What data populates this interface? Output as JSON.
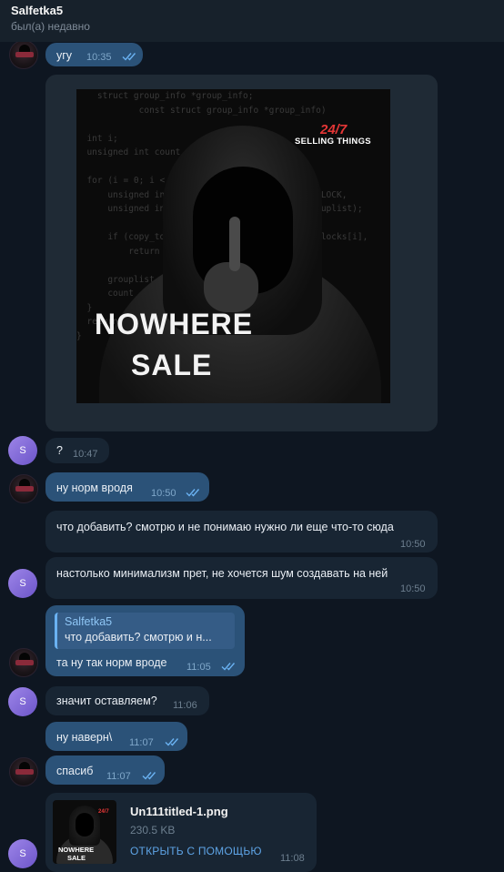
{
  "header": {
    "name": "Salfetka5",
    "status": "был(а) недавно"
  },
  "avatar_letter": "S",
  "poster": {
    "tag_top": "24/7",
    "tag_sub": "SELLING THINGS",
    "title_line1": "NOWHERE",
    "title_line2": "SALE",
    "code": "    struct group_info *group_info;\n            const struct group_info *group_info)\n\n  int i;\n  unsigned int count = group_info->ngroups;\n\n  for (i = 0; i < group_info->nblocks; i++) {\n      unsigned int cp_count = min(NGROUPS_PER_BLOCK,\n      unsigned int len = cp_count * sizeof(*grouplist);\n\n      if (copy_to_user(grouplist, group_info->blocks[i],\n          return -EFAULT;\n\n      grouplist += NGROUPS_PER_BLOCK;\n      count -= cp_count;\n  }\n  return 0;\n}"
  },
  "messages": {
    "m1": {
      "text": "угу",
      "time": "10:35"
    },
    "m2": {
      "text": "?",
      "time": "10:47"
    },
    "m3": {
      "text": "ну норм вродя",
      "time": "10:50"
    },
    "m4": {
      "text": "что добавить? смотрю и не понимаю нужно ли еще что-то сюда",
      "time": "10:50"
    },
    "m5": {
      "text": "настолько минимализм прет, не хочется шум создавать на ней",
      "time": "10:50"
    },
    "m6": {
      "reply_name": "Salfetka5",
      "reply_text": "что добавить? смотрю и н...",
      "text": "та ну так норм вроде",
      "time": "11:05"
    },
    "m7": {
      "text": "значит оставляем?",
      "time": "11:06"
    },
    "m8": {
      "text": "ну наверн\\",
      "time": "11:07"
    },
    "m9": {
      "text": "спасиб",
      "time": "11:07"
    }
  },
  "file": {
    "name": "Un111titled-1.png",
    "size": "230.5 KB",
    "open_label": "ОТКРЫТЬ С ПОМОЩЬЮ",
    "time": "11:08",
    "thumb_line1": "NOWHERE",
    "thumb_line2": "SALE",
    "thumb_tag": "24/7"
  },
  "colors": {
    "background": "#0e1621",
    "outgoing_bubble": "#2b5278",
    "incoming_bubble": "#182533",
    "accent": "#5ea4e6"
  }
}
